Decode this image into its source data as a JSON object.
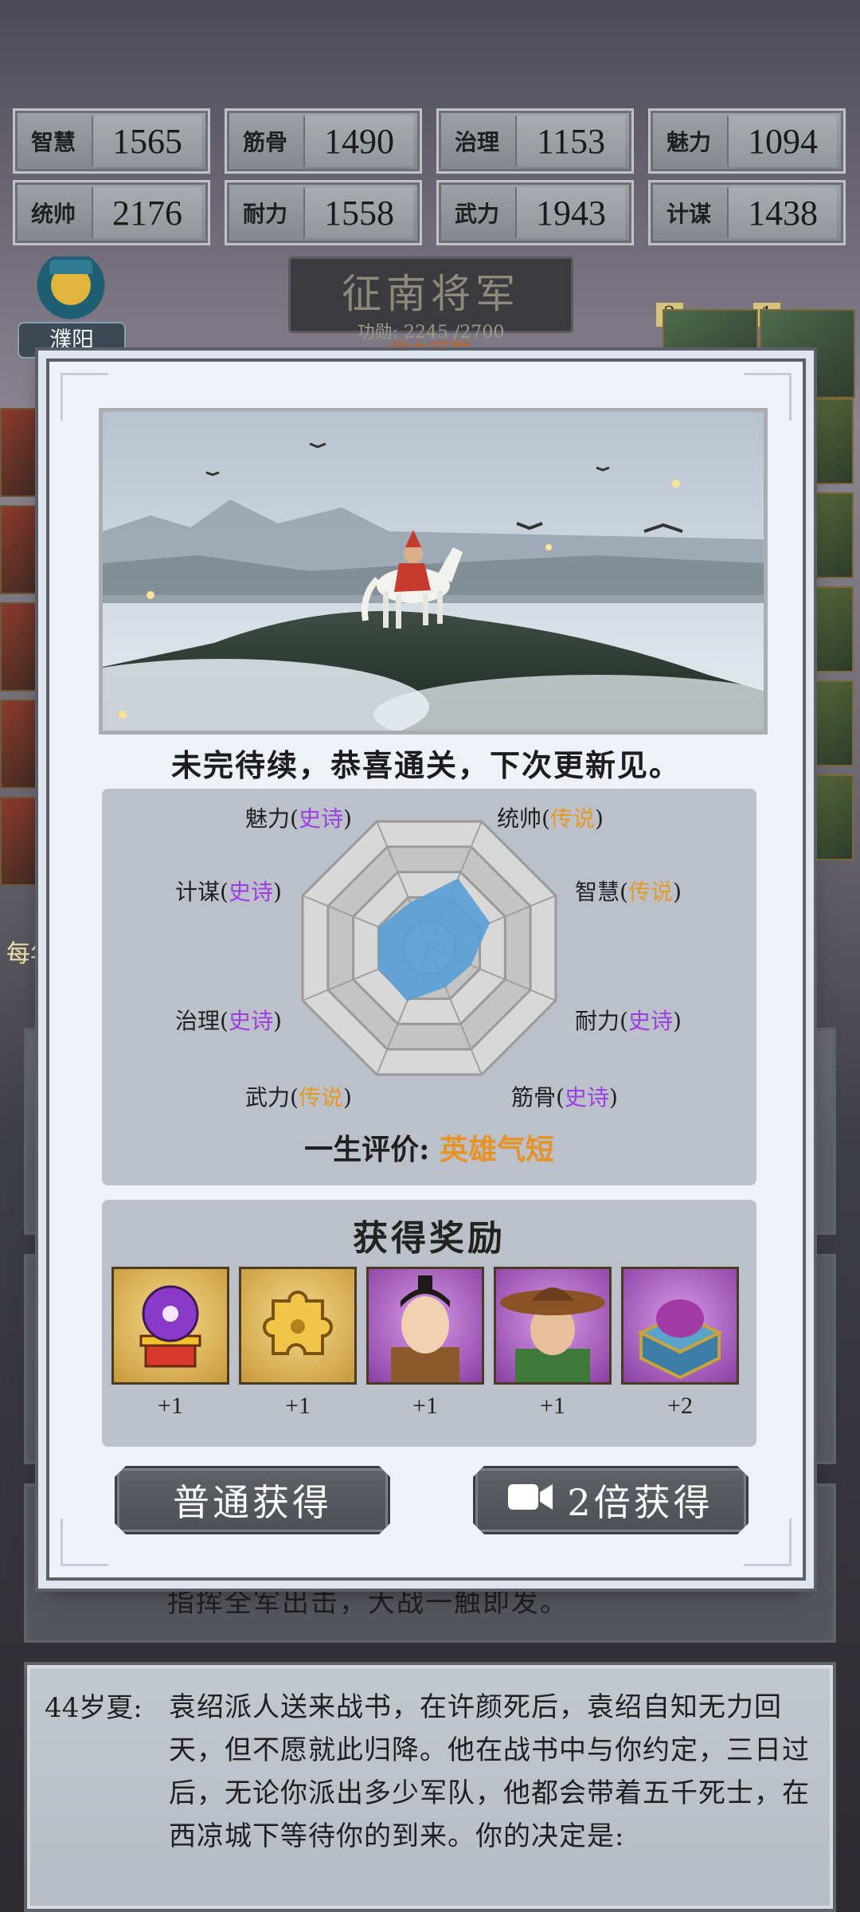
{
  "stats": [
    {
      "label": "智慧",
      "value": "1565"
    },
    {
      "label": "筋骨",
      "value": "1490"
    },
    {
      "label": "治理",
      "value": "1153"
    },
    {
      "label": "魅力",
      "value": "1094"
    },
    {
      "label": "统帅",
      "value": "2176"
    },
    {
      "label": "耐力",
      "value": "1558"
    },
    {
      "label": "武力",
      "value": "1943"
    },
    {
      "label": "计谋",
      "value": "1438"
    }
  ],
  "city": {
    "name": "濮阳"
  },
  "rank": {
    "title": "征南将军",
    "merit": "功勋: 2245 /2700",
    "subtitle": "武力超群"
  },
  "side_badges": [
    "2",
    "1"
  ],
  "left_hint": "每年",
  "bg_line": "指挥全军出击，大战一触即发。",
  "event": {
    "age": "44岁夏:",
    "text": "袁绍派人送来战书，在许颜死后，袁绍自知无力回天，但不愿就此归降。他在战书中与你约定，三日过后，无论你派出多少军队，他都会带着五千死士，在西凉城下等待你的到来。你的决定是:"
  },
  "modal": {
    "message": "未完待续，恭喜通关，下次更新见。",
    "radar": {
      "axes": [
        {
          "name": "统帅",
          "tier": "传说"
        },
        {
          "name": "智慧",
          "tier": "传说"
        },
        {
          "name": "耐力",
          "tier": "史诗"
        },
        {
          "name": "筋骨",
          "tier": "史诗"
        },
        {
          "name": "武力",
          "tier": "传说"
        },
        {
          "name": "治理",
          "tier": "史诗"
        },
        {
          "name": "计谋",
          "tier": "史诗"
        },
        {
          "name": "魅力",
          "tier": "史诗"
        }
      ],
      "values": [
        0.55,
        0.48,
        0.33,
        0.31,
        0.42,
        0.4,
        0.4,
        0.36
      ],
      "fill_color": "#5b9fd6"
    },
    "life_eval_label": "一生评价:",
    "life_eval_value": "英雄气短",
    "reward_title": "获得奖励",
    "rewards": [
      {
        "icon": "crystal-orb-icon",
        "count": "+1"
      },
      {
        "icon": "puzzle-piece-icon",
        "count": "+1"
      },
      {
        "icon": "scholar-portrait",
        "count": "+1"
      },
      {
        "icon": "hat-hero-portrait",
        "count": "+1"
      },
      {
        "icon": "treasure-chest-icon",
        "count": "+2"
      }
    ],
    "btn_normal": "普通获得",
    "btn_double": "2倍获得"
  },
  "colors": {
    "epic": "#9b3fe0",
    "legend": "#e29a2a",
    "accent": "#e69327"
  }
}
